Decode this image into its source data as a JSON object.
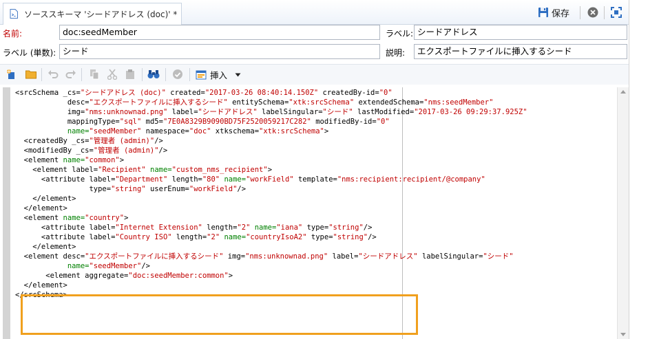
{
  "tab": {
    "title": "ソーススキーマ 'シードアドレス (doc)' *",
    "icon": "schema-file-icon"
  },
  "toolbar": {
    "save_label": "保存",
    "save_icon": "floppy-disk-icon",
    "close_icon": "close-circle-icon",
    "fullscreen_icon": "fullscreen-icon"
  },
  "form": {
    "name_label": "名前:",
    "name_value": "doc:seedMember",
    "label_label": "ラベル:",
    "label_value": "シードアドレス",
    "singular_label": "ラベル (単数):",
    "singular_value": "シード",
    "desc_label": "説明:",
    "desc_value": "エクスポートファイルに挿入するシード"
  },
  "editor_toolbar": {
    "insert_label": "挿入"
  },
  "code": [
    [
      [
        "t",
        "<srcSchema "
      ],
      [
        "an",
        "_cs="
      ],
      [
        "av",
        "\"シードアドレス (doc)\""
      ],
      [
        "an",
        " created="
      ],
      [
        "av",
        "\"2017-03-26 08:40:14.150Z\""
      ],
      [
        "an",
        " createdBy-id="
      ],
      [
        "av",
        "\"0\""
      ]
    ],
    [
      [
        "t",
        "            "
      ],
      [
        "an",
        "desc="
      ],
      [
        "av",
        "\"エクスポートファイルに挿入するシード\""
      ],
      [
        "an",
        " entitySchema="
      ],
      [
        "av",
        "\"xtk:srcSchema\""
      ],
      [
        "an",
        " extendedSchema="
      ],
      [
        "av",
        "\"nms:seedMember\""
      ]
    ],
    [
      [
        "t",
        "            "
      ],
      [
        "an",
        "img="
      ],
      [
        "av",
        "\"nms:unknownad.png\""
      ],
      [
        "an",
        " label="
      ],
      [
        "av",
        "\"シードアドレス\""
      ],
      [
        "an",
        " labelSingular="
      ],
      [
        "av",
        "\"シード\""
      ],
      [
        "an",
        " lastModified="
      ],
      [
        "av",
        "\"2017-03-26 09:29:37.925Z\""
      ]
    ],
    [
      [
        "t",
        "            "
      ],
      [
        "an",
        "mappingType="
      ],
      [
        "av",
        "\"sql\""
      ],
      [
        "an",
        " md5="
      ],
      [
        "av",
        "\"7E0A8329B9090BD75F2520059217C282\""
      ],
      [
        "an",
        " modifiedBy-id="
      ],
      [
        "av",
        "\"0\""
      ]
    ],
    [
      [
        "t",
        "            "
      ],
      [
        "ag",
        "name="
      ],
      [
        "av",
        "\"seedMember\""
      ],
      [
        "an",
        " namespace="
      ],
      [
        "av",
        "\"doc\""
      ],
      [
        "an",
        " xtkschema="
      ],
      [
        "av",
        "\"xtk:srcSchema\""
      ],
      [
        "t",
        ">"
      ]
    ],
    [
      [
        "t",
        "  <createdBy "
      ],
      [
        "an",
        "_cs="
      ],
      [
        "av",
        "\"管理者 (admin)\""
      ],
      [
        "t",
        "/>"
      ]
    ],
    [
      [
        "t",
        "  <modifiedBy "
      ],
      [
        "an",
        "_cs="
      ],
      [
        "av",
        "\"管理者 (admin)\""
      ],
      [
        "t",
        "/>"
      ]
    ],
    [
      [
        "t",
        "  <element "
      ],
      [
        "ag",
        "name="
      ],
      [
        "av",
        "\"common\""
      ],
      [
        "t",
        ">"
      ]
    ],
    [
      [
        "t",
        "    <element "
      ],
      [
        "an",
        "label="
      ],
      [
        "av",
        "\"Recipient\""
      ],
      [
        "ag",
        " name="
      ],
      [
        "av",
        "\"custom_nms_recipient\""
      ],
      [
        "t",
        ">"
      ]
    ],
    [
      [
        "t",
        "      <attribute "
      ],
      [
        "an",
        "label="
      ],
      [
        "av",
        "\"Department\""
      ],
      [
        "an",
        " length="
      ],
      [
        "av",
        "\"80\""
      ],
      [
        "ag",
        " name="
      ],
      [
        "av",
        "\"workField\""
      ],
      [
        "an",
        " template="
      ],
      [
        "av",
        "\"nms:recipient:recipient/@company\""
      ]
    ],
    [
      [
        "t",
        "                 "
      ],
      [
        "an",
        "type="
      ],
      [
        "av",
        "\"string\""
      ],
      [
        "an",
        " userEnum="
      ],
      [
        "av",
        "\"workField\""
      ],
      [
        "t",
        "/>"
      ]
    ],
    [
      [
        "t",
        "    </element>"
      ]
    ],
    [
      [
        "t",
        "  </element>"
      ]
    ],
    [
      [
        "t",
        "  <element "
      ],
      [
        "ag",
        "name="
      ],
      [
        "av",
        "\"country\""
      ],
      [
        "t",
        ">"
      ]
    ],
    [
      [
        "t",
        "      <attribute "
      ],
      [
        "an",
        "label="
      ],
      [
        "av",
        "\"Internet Extension\""
      ],
      [
        "an",
        " length="
      ],
      [
        "av",
        "\"2\""
      ],
      [
        "ag",
        " name="
      ],
      [
        "av",
        "\"iana\""
      ],
      [
        "an",
        " type="
      ],
      [
        "av",
        "\"string\""
      ],
      [
        "t",
        "/>"
      ]
    ],
    [
      [
        "t",
        "      <attribute "
      ],
      [
        "an",
        "label="
      ],
      [
        "av",
        "\"Country ISO\""
      ],
      [
        "an",
        " length="
      ],
      [
        "av",
        "\"2\""
      ],
      [
        "ag",
        " name="
      ],
      [
        "av",
        "\"countryIsoA2\""
      ],
      [
        "an",
        " type="
      ],
      [
        "av",
        "\"string\""
      ],
      [
        "t",
        "/>"
      ]
    ],
    [
      [
        "t",
        "    </element>"
      ]
    ],
    [
      [
        "t",
        "  <element "
      ],
      [
        "an",
        "desc="
      ],
      [
        "av",
        "\"エクスポートファイルに挿入するシード\""
      ],
      [
        "an",
        " img="
      ],
      [
        "av",
        "\"nms:unknownad.png\""
      ],
      [
        "an",
        " label="
      ],
      [
        "av",
        "\"シードアドレス\""
      ],
      [
        "an",
        " labelSingular="
      ],
      [
        "av",
        "\"シード\""
      ]
    ],
    [
      [
        "t",
        "            "
      ],
      [
        "ag",
        "name="
      ],
      [
        "av",
        "\"seedMember\""
      ],
      [
        "t",
        "/>"
      ]
    ],
    [
      [
        "t",
        "       <element "
      ],
      [
        "an",
        "aggregate="
      ],
      [
        "av",
        "\"doc:seedMember:common\""
      ],
      [
        "t",
        ">"
      ]
    ],
    [
      [
        "t",
        "  </element>"
      ]
    ],
    [
      [
        "t",
        "</srcSchema>"
      ]
    ]
  ],
  "colors": {
    "attr_value": "#c00000",
    "attr_name_key": "#008000",
    "highlight": "#f0a01e",
    "required_label": "#c00000"
  }
}
